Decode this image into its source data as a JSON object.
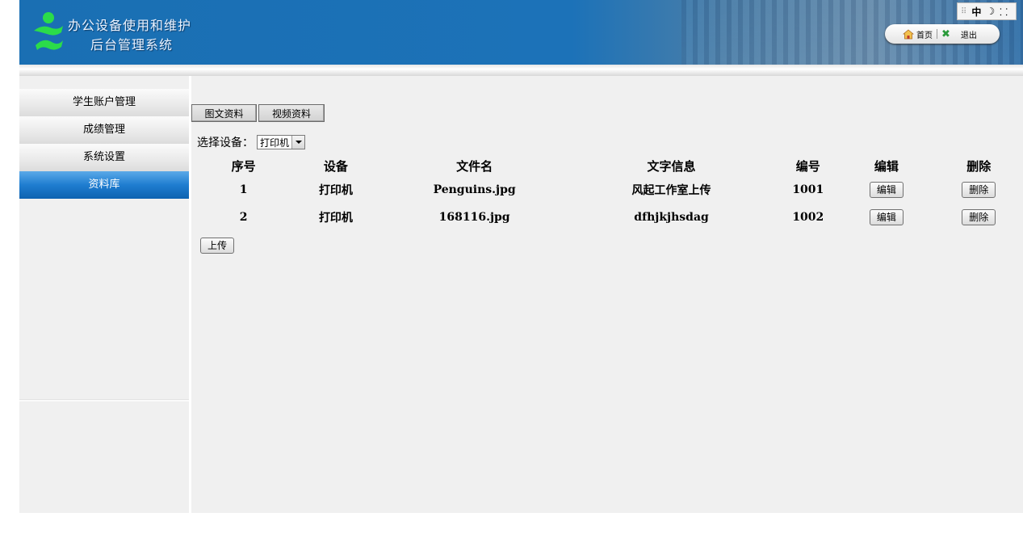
{
  "header": {
    "title_line1": "办公设备使用和维护",
    "title_line2": "后台管理系统",
    "home_label": "首页",
    "exit_label": "退出",
    "ime_label": "中",
    "ime_moon": "☽",
    "ime_punct": "⸬"
  },
  "sidebar": {
    "items": [
      {
        "label": "学生账户管理",
        "active": false
      },
      {
        "label": "成绩管理",
        "active": false
      },
      {
        "label": "系统设置",
        "active": false
      },
      {
        "label": "资料库",
        "active": true
      }
    ]
  },
  "main": {
    "tabs": [
      {
        "label": "图文资料"
      },
      {
        "label": "视频资料"
      }
    ],
    "device_select": {
      "label": "选择设备：",
      "value": "打印机"
    },
    "table": {
      "columns": [
        "序号",
        "设备",
        "文件名",
        "文字信息",
        "编号",
        "编辑",
        "删除"
      ],
      "rows": [
        {
          "index": "1",
          "device": "打印机",
          "filename": "Penguins.jpg",
          "text": "风起工作室上传",
          "code": "1001",
          "edit": "编辑",
          "delete": "删除"
        },
        {
          "index": "2",
          "device": "打印机",
          "filename": "168116.jpg",
          "text": "dfhjkjhsdag",
          "code": "1002",
          "edit": "编辑",
          "delete": "删除"
        }
      ]
    },
    "upload_label": "上传"
  },
  "colors": {
    "header_blue": "#1a6fb3",
    "active_menu": "#1f7dd0",
    "panel_bg": "#f0f0f0"
  }
}
